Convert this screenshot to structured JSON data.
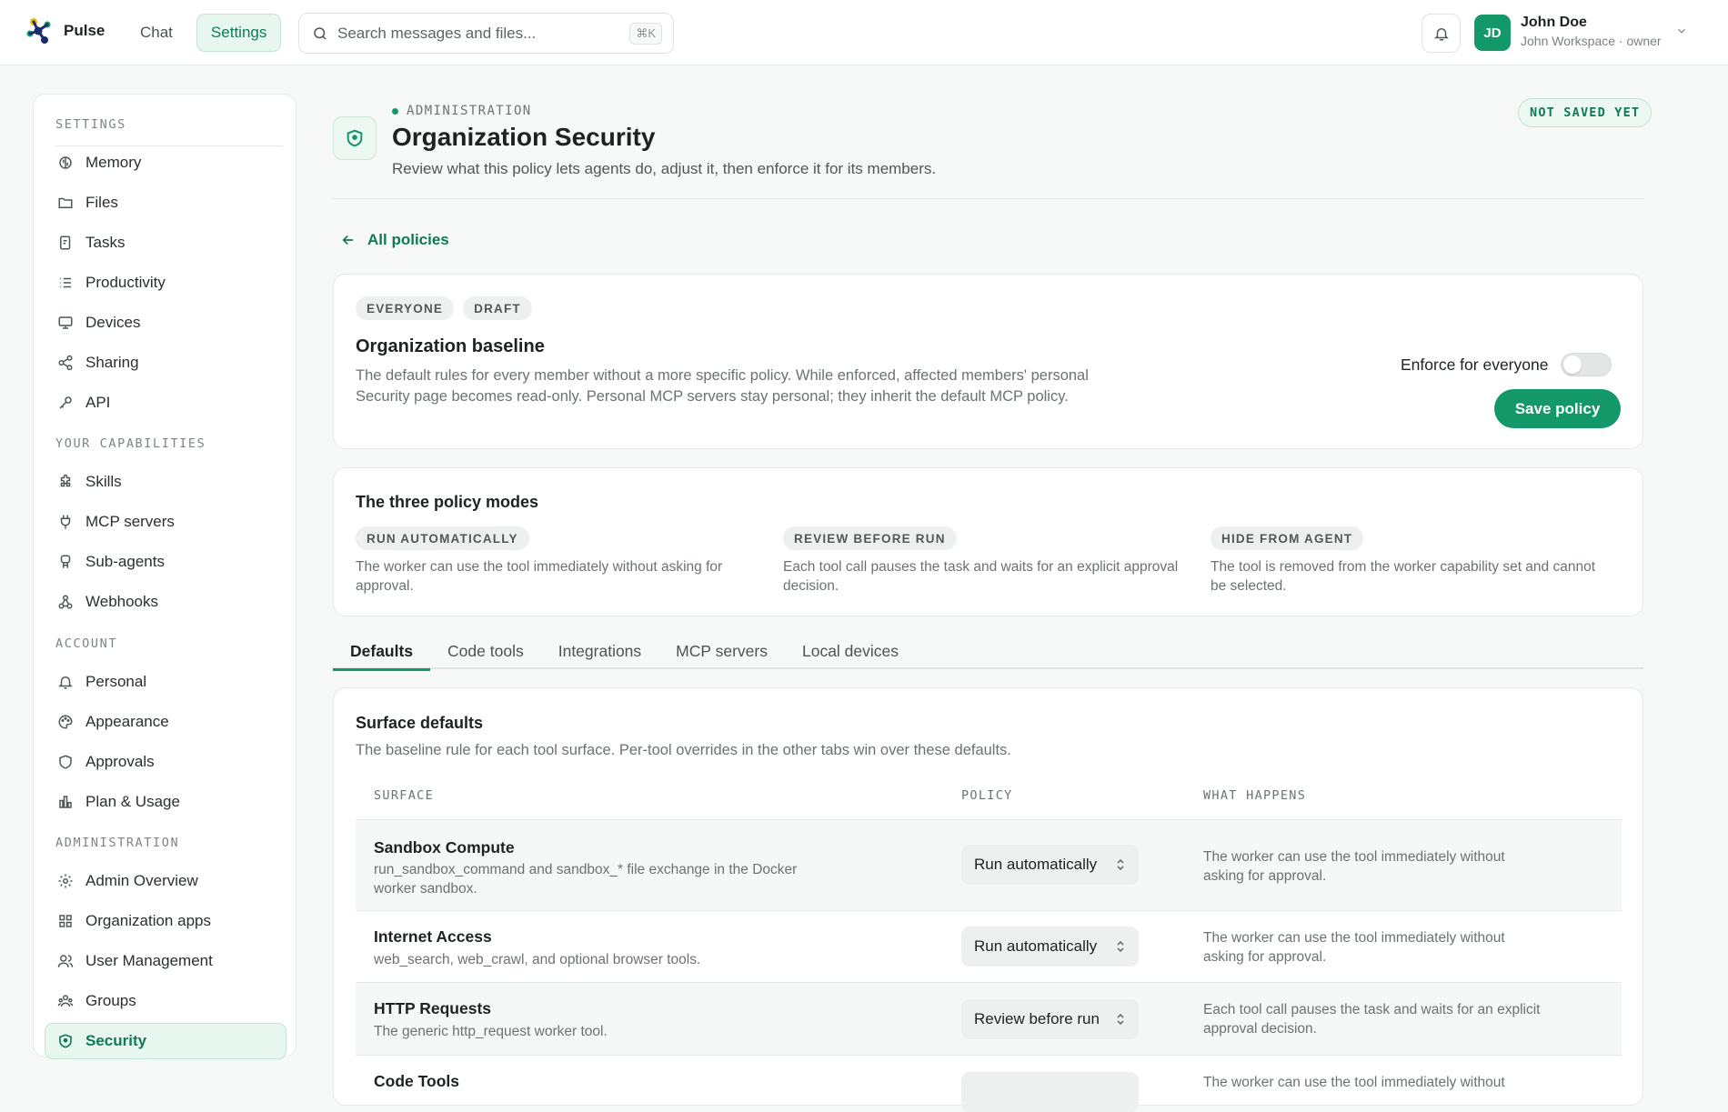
{
  "app": {
    "name": "Pulse"
  },
  "topnav": {
    "items": [
      {
        "label": "Chat"
      },
      {
        "label": "Settings",
        "active": true
      }
    ]
  },
  "search": {
    "placeholder": "Search messages and files...",
    "shortcut": "⌘K"
  },
  "user": {
    "initials": "JD",
    "name": "John Doe",
    "subtitle": "John Workspace · owner"
  },
  "sidebar": {
    "sections": [
      {
        "title": "SETTINGS",
        "items": [
          {
            "label": "Memory",
            "icon": "brain-icon"
          },
          {
            "label": "Files",
            "icon": "folder-icon"
          },
          {
            "label": "Tasks",
            "icon": "tasks-icon"
          },
          {
            "label": "Productivity",
            "icon": "list-icon"
          },
          {
            "label": "Devices",
            "icon": "monitor-icon"
          },
          {
            "label": "Sharing",
            "icon": "share-icon"
          },
          {
            "label": "API",
            "icon": "key-icon"
          }
        ]
      },
      {
        "title": "YOUR CAPABILITIES",
        "items": [
          {
            "label": "Skills",
            "icon": "puzzle-icon"
          },
          {
            "label": "MCP servers",
            "icon": "plug-icon"
          },
          {
            "label": "Sub-agents",
            "icon": "bot-icon"
          },
          {
            "label": "Webhooks",
            "icon": "webhook-icon"
          }
        ]
      },
      {
        "title": "ACCOUNT",
        "items": [
          {
            "label": "Personal",
            "icon": "bell-icon"
          },
          {
            "label": "Appearance",
            "icon": "palette-icon"
          },
          {
            "label": "Approvals",
            "icon": "shield-check-icon"
          },
          {
            "label": "Plan & Usage",
            "icon": "bar-chart-icon"
          }
        ]
      },
      {
        "title": "ADMINISTRATION",
        "items": [
          {
            "label": "Admin Overview",
            "icon": "gear-icon"
          },
          {
            "label": "Organization apps",
            "icon": "apps-icon"
          },
          {
            "label": "User Management",
            "icon": "users-icon"
          },
          {
            "label": "Groups",
            "icon": "group-icon"
          },
          {
            "label": "Security",
            "icon": "shield-icon",
            "active": true
          }
        ]
      }
    ]
  },
  "header": {
    "eyebrow": "ADMINISTRATION",
    "title": "Organization Security",
    "subtitle": "Review what this policy lets agents do, adjust it, then enforce it for its members.",
    "status_badge": "NOT SAVED YET",
    "back_link": "All policies"
  },
  "policy": {
    "chips": [
      "EVERYONE",
      "DRAFT"
    ],
    "title": "Organization baseline",
    "description": "The default rules for every member without a more specific policy. While enforced, affected members' personal Security page becomes read-only. Personal MCP servers stay personal; they inherit the default MCP policy.",
    "enforce_label": "Enforce for everyone",
    "enforced": false,
    "save_label": "Save policy"
  },
  "modes": {
    "title": "The three policy modes",
    "items": [
      {
        "label": "RUN AUTOMATICALLY",
        "description": "The worker can use the tool immediately without asking for approval."
      },
      {
        "label": "REVIEW BEFORE RUN",
        "description": "Each tool call pauses the task and waits for an explicit approval decision."
      },
      {
        "label": "HIDE FROM AGENT",
        "description": "The tool is removed from the worker capability set and cannot be selected."
      }
    ]
  },
  "tabs": [
    {
      "label": "Defaults",
      "active": true
    },
    {
      "label": "Code tools"
    },
    {
      "label": "Integrations"
    },
    {
      "label": "MCP servers"
    },
    {
      "label": "Local devices"
    }
  ],
  "surface_defaults": {
    "title": "Surface defaults",
    "subtitle": "The baseline rule for each tool surface. Per-tool overrides in the other tabs win over these defaults.",
    "columns": [
      "SURFACE",
      "POLICY",
      "WHAT HAPPENS"
    ],
    "rows": [
      {
        "name": "Sandbox Compute",
        "description": "run_sandbox_command and sandbox_* file exchange in the Docker worker sandbox.",
        "policy": "Run automatically",
        "what": "The worker can use the tool immediately without asking for approval."
      },
      {
        "name": "Internet Access",
        "description": "web_search, web_crawl, and optional browser tools.",
        "policy": "Run automatically",
        "what": "The worker can use the tool immediately without asking for approval."
      },
      {
        "name": "HTTP Requests",
        "description": "The generic http_request worker tool.",
        "policy": "Review before run",
        "what": "Each tool call pauses the task and waits for an explicit approval decision."
      },
      {
        "name": "Code Tools",
        "description": "",
        "policy": "",
        "what": "The worker can use the tool immediately without"
      }
    ]
  },
  "colors": {
    "accent": "#13986a",
    "accent_soft": "#e7f6ef",
    "text": "#1d2321",
    "muted": "#6b7371"
  }
}
